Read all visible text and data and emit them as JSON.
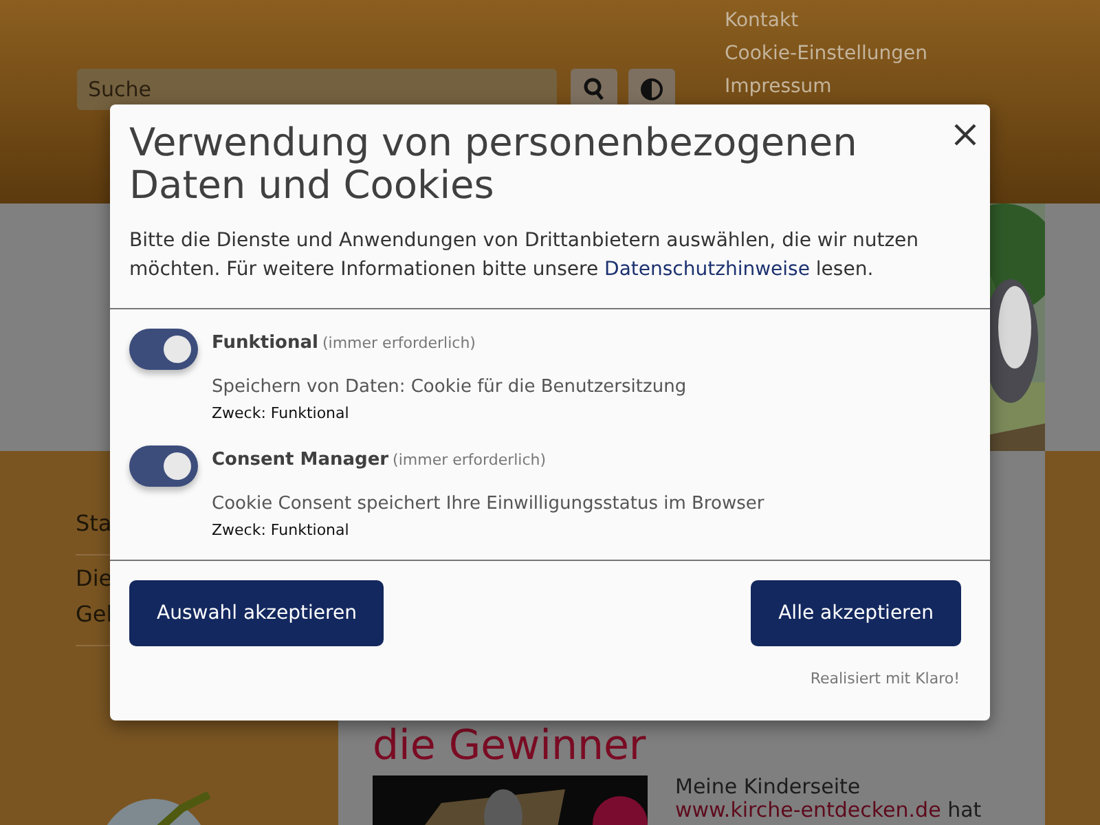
{
  "header": {
    "search": {
      "placeholder": "Suche"
    },
    "nav": [
      "Kontakt",
      "Cookie-Einstellungen",
      "Impressum"
    ]
  },
  "sidebar": {
    "items": [
      {
        "lines": [
          "Sta"
        ]
      },
      {
        "lines": [
          "Die",
          "Gel"
        ]
      }
    ]
  },
  "content": {
    "heading": "die Gewinner",
    "text": "Meine Kinderseite",
    "link": "www.kirche-entdecken.de",
    "text_after": "hat"
  },
  "consent": {
    "title": "Verwendung von personenbezogenen Daten und Cookies",
    "intro": "Bitte die Dienste und Anwendungen von Drittanbietern auswählen, die wir nutzen möchten. Für weitere Informationen bitte unsere",
    "intro_link": "Datenschutzhinweise",
    "intro_after": "lesen.",
    "services": [
      {
        "name": "Funktional",
        "note": "(immer erforderlich)",
        "checked": true,
        "description": "Speichern von Daten: Cookie für die Benutzersitzung",
        "purpose": "Zweck: Funktional"
      },
      {
        "name": "Consent Manager",
        "note": "(immer erforderlich)",
        "checked": true,
        "description": "Cookie Consent speichert Ihre Einwilligungsstatus im Browser",
        "purpose": "Zweck: Funktional"
      }
    ],
    "buttons": [
      "Auswahl akzeptieren",
      "Alle akzeptieren"
    ],
    "footer": "Realisiert mit Klaro!"
  }
}
